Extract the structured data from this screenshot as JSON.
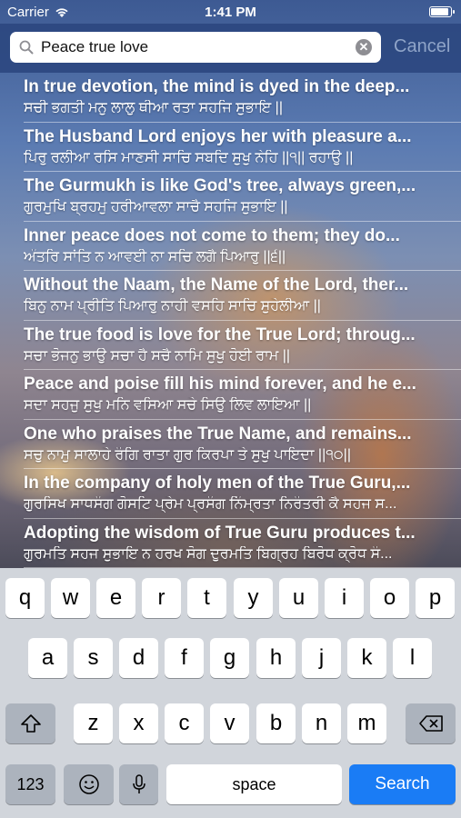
{
  "status": {
    "carrier": "Carrier",
    "time": "1:41 PM"
  },
  "search": {
    "query": "Peace true love",
    "cancel_label": "Cancel"
  },
  "results": [
    {
      "english": "In true devotion, the mind is dyed in the deep...",
      "gurmukhi": "ਸਚੀ ਭਗਤੀ ਮਨੁ ਲਾਲੁ ਥੀਆ ਰਤਾ ਸਹਜਿ ਸੁਭਾਇ ||"
    },
    {
      "english": "The Husband Lord enjoys her with pleasure a...",
      "gurmukhi": "ਪਿਰੁ ਰਲੀਆ ਰਸਿ ਮਾਣਸੀ ਸਾਚਿ ਸਬਦਿ ਸੁਖੁ ਨੇਹਿ ||੧|| ਰਹਾਉ ||"
    },
    {
      "english": "The Gurmukh is like God's tree, always green,...",
      "gurmukhi": "ਗੁਰਮੁਖਿ ਬ੍ਰਹਮੁ ਹਰੀਆਵਲਾ ਸਾਚੈ ਸਹਜਿ ਸੁਭਾਇ ||"
    },
    {
      "english": "Inner peace does not come to them; they do...",
      "gurmukhi": "ਅੰਤਰਿ ਸਾਂਤਿ ਨ ਆਵਈ ਨਾ ਸਚਿ ਲਗੈ ਪਿਆਰੁ ||੬||"
    },
    {
      "english": "Without the Naam, the Name of the Lord, ther...",
      "gurmukhi": "ਬਿਨੁ ਨਾਮ ਪ੍ਰੀਤਿ ਪਿਆਰੁ ਨਾਹੀ ਵਸਹਿ ਸਾਚਿ ਸੁਹੇਲੀਆ ||"
    },
    {
      "english": "The true food is love for the True Lord; throug...",
      "gurmukhi": "ਸਚਾ ਭੋਜਨੁ ਭਾਉ ਸਚਾ ਹੈ ਸਚੈ ਨਾਮਿ ਸੁਖੁ ਹੋਈ ਰਾਮ ||"
    },
    {
      "english": "Peace and poise fill his mind forever, and he e...",
      "gurmukhi": "ਸਦਾ ਸਹਜੁ ਸੁਖੁ ਮਨਿ ਵਸਿਆ ਸਚੇ ਸਿਉ ਲਿਵ ਲਾਇਆ ||"
    },
    {
      "english": "One who praises the True Name, and remains...",
      "gurmukhi": "ਸਚੁ ਨਾਮੁ ਸਾਲਾਹੇ ਰੰਗਿ ਰਾਤਾ ਗੁਰ ਕਿਰਪਾ ਤੇ ਸੁਖੁ ਪਾਇਦਾ ||੧੦||"
    },
    {
      "english": "In the company of holy men of the True Guru,...",
      "gurmukhi": "ਗੁਰਸਿਖ ਸਾਧਸੰਗ ਗੋਸਟਿ ਪ੍ਰੇਮ ਪ੍ਰਸੰਗ ਨਿੰਮ੍ਰਤਾ ਨਿਰੰਤਰੀ ਕੈ ਸਹਜ ਸ..."
    },
    {
      "english": "Adopting the wisdom of True Guru produces t...",
      "gurmukhi": "ਗੁਰਮਤਿ ਸਹਜ ਸੁਭਾਇ ਨ ਹਰਖ ਸੋਗ ਦੁਰਮਤਿ ਬਿਗ੍ਰਹ ਬਿਰੋਧ ਕ੍ਰੋਧ ਸੰ..."
    }
  ],
  "keyboard": {
    "row1": [
      "q",
      "w",
      "e",
      "r",
      "t",
      "y",
      "u",
      "i",
      "o",
      "p"
    ],
    "row2": [
      "a",
      "s",
      "d",
      "f",
      "g",
      "h",
      "j",
      "k",
      "l"
    ],
    "row3": [
      "z",
      "x",
      "c",
      "v",
      "b",
      "n",
      "m"
    ],
    "numbers_label": "123",
    "space_label": "space",
    "search_label": "Search"
  },
  "colors": {
    "search_key": "#1a7cf5",
    "keyboard_bg": "#d1d5db",
    "nav_bg": "#2c4880"
  }
}
